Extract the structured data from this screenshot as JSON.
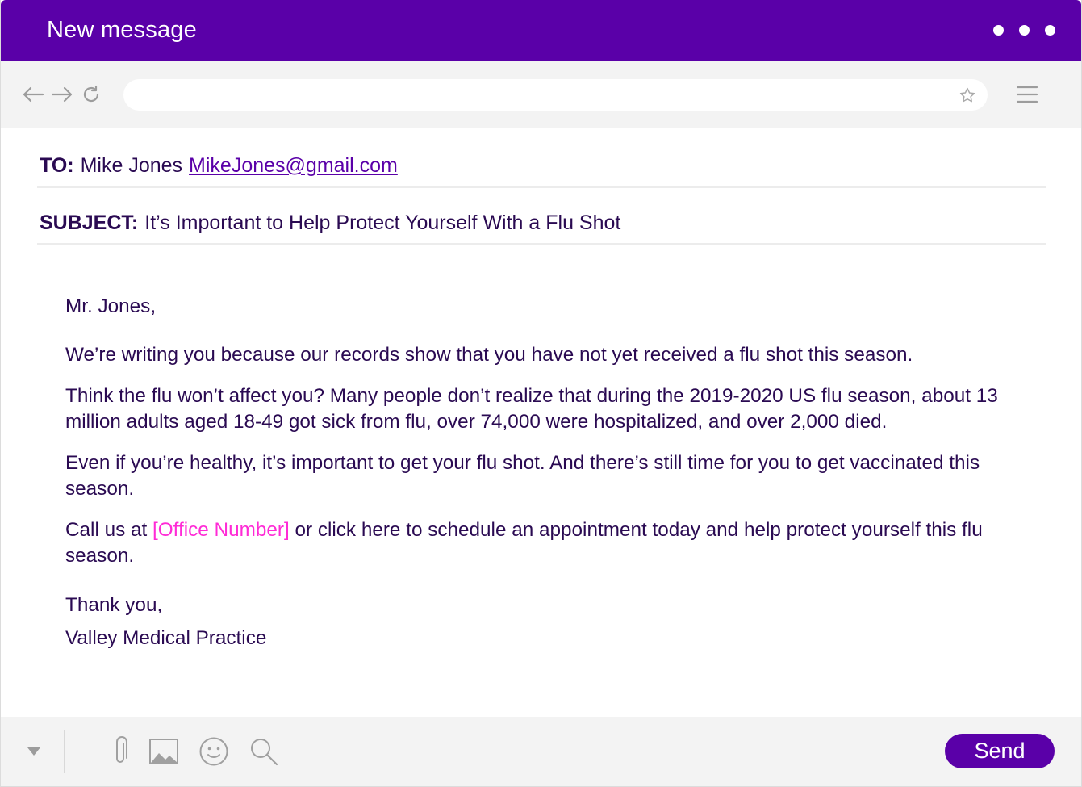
{
  "window": {
    "title": "New message"
  },
  "browser": {
    "url_value": ""
  },
  "to": {
    "label": "TO:",
    "name": "Mike Jones",
    "email": "MikeJones@gmail.com"
  },
  "subject": {
    "label": "SUBJECT:",
    "value": "It’s Important to Help Protect Yourself With a Flu Shot"
  },
  "message": {
    "greeting": "Mr. Jones,",
    "p1": "We’re writing you because our records show that you have not yet received a flu shot this season.",
    "p2": "Think the flu won’t affect you? Many people don’t realize that during the 2019-2020 US flu season, about 13 million adults aged 18-49 got sick from flu, over 74,000 were hospitalized, and over 2,000 died.",
    "p3": "Even if you’re healthy, it’s important to get your flu shot. And there’s still time for you to get vaccinated this season.",
    "p4_before": "Call us at ",
    "p4_placeholder": "[Office Number]",
    "p4_after": " or click here to schedule an appointment today and help protect yourself this flu season.",
    "closing": "Thank you,",
    "signature": "Valley Medical Practice"
  },
  "footer": {
    "send_label": "Send"
  },
  "icons": {
    "window_menu": "more-dots-icon",
    "back": "arrow-left-icon",
    "forward": "arrow-right-icon",
    "reload": "reload-icon",
    "bookmark": "star-icon",
    "browser_menu": "hamburger-icon",
    "more_options": "caret-down-icon",
    "attach": "paperclip-icon",
    "image": "image-icon",
    "emoji": "smiley-icon",
    "search": "search-icon"
  },
  "colors": {
    "brand": "#5a00a8",
    "text": "#2a0a52",
    "placeholder": "#ff2bd6",
    "toolbar_bg": "#f3f3f3"
  }
}
